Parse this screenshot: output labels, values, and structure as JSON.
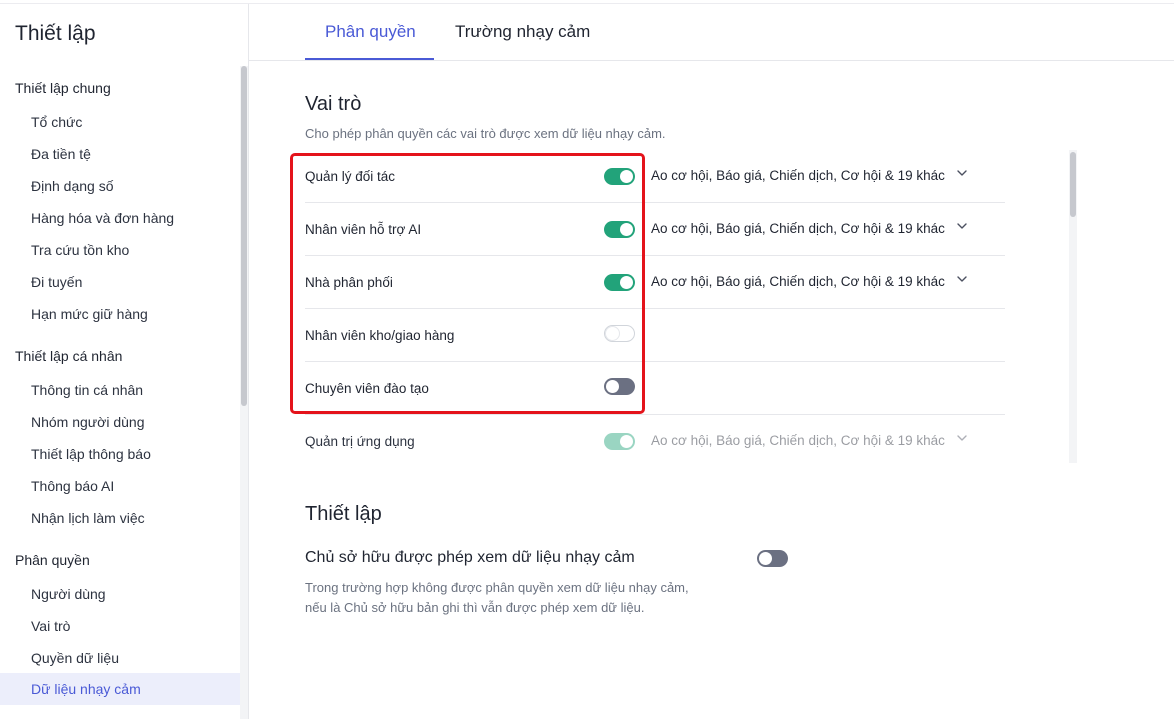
{
  "sidebar": {
    "title": "Thiết lập",
    "groups": [
      {
        "label": "Thiết lập chung",
        "items": [
          "Tổ chức",
          "Đa tiền tệ",
          "Định dạng số",
          "Hàng hóa và đơn hàng",
          "Tra cứu tồn kho",
          "Đi tuyến",
          "Hạn mức giữ hàng"
        ]
      },
      {
        "label": "Thiết lập cá nhân",
        "items": [
          "Thông tin cá nhân",
          "Nhóm người dùng",
          "Thiết lập thông báo",
          "Thông báo AI",
          "Nhận lịch làm việc"
        ]
      },
      {
        "label": "Phân quyền",
        "items": [
          "Người dùng",
          "Vai trò",
          "Quyền dữ liệu",
          "Dữ liệu nhạy cảm"
        ]
      }
    ],
    "active_item": "Dữ liệu nhạy cảm"
  },
  "tabs": [
    {
      "label": "Phân quyền",
      "active": true
    },
    {
      "label": "Trường nhạy cảm",
      "active": false
    }
  ],
  "roles_section": {
    "title": "Vai trò",
    "description": "Cho phép phân quyền các vai trò được xem dữ liệu nhạy cảm.",
    "roles": [
      {
        "name": "Quản lý đối tác",
        "enabled": true,
        "permissions": "Ao cơ hội, Báo giá, Chiến dịch, Cơ hội & 19 khác"
      },
      {
        "name": "Nhân viên hỗ trợ AI",
        "enabled": true,
        "permissions": "Ao cơ hội, Báo giá, Chiến dịch, Cơ hội & 19 khác"
      },
      {
        "name": "Nhà phân phối",
        "enabled": true,
        "permissions": "Ao cơ hội, Báo giá, Chiến dịch, Cơ hội & 19 khác"
      },
      {
        "name": "Nhân viên kho/giao hàng",
        "enabled": false,
        "permissions": ""
      },
      {
        "name": "Chuyên viên đào tạo",
        "enabled": false,
        "permissions": ""
      },
      {
        "name": "Quản trị ứng dụng",
        "enabled": true,
        "permissions": "Ao cơ hội, Báo giá, Chiến dịch, Cơ hội & 19 khác"
      }
    ]
  },
  "settings_section": {
    "title": "Thiết lập",
    "owner_label": "Chủ sở hữu được phép xem dữ liệu nhạy cảm",
    "owner_enabled": false,
    "owner_desc_line1": "Trong trường hợp không được phân quyền xem dữ liệu nhạy cảm,",
    "owner_desc_line2": "nếu là Chủ sở hữu bản ghi thì vẫn được phép xem dữ liệu."
  },
  "colors": {
    "accent": "#4a5ad6",
    "toggle_on": "#22a37a",
    "highlight": "#e4131b"
  }
}
